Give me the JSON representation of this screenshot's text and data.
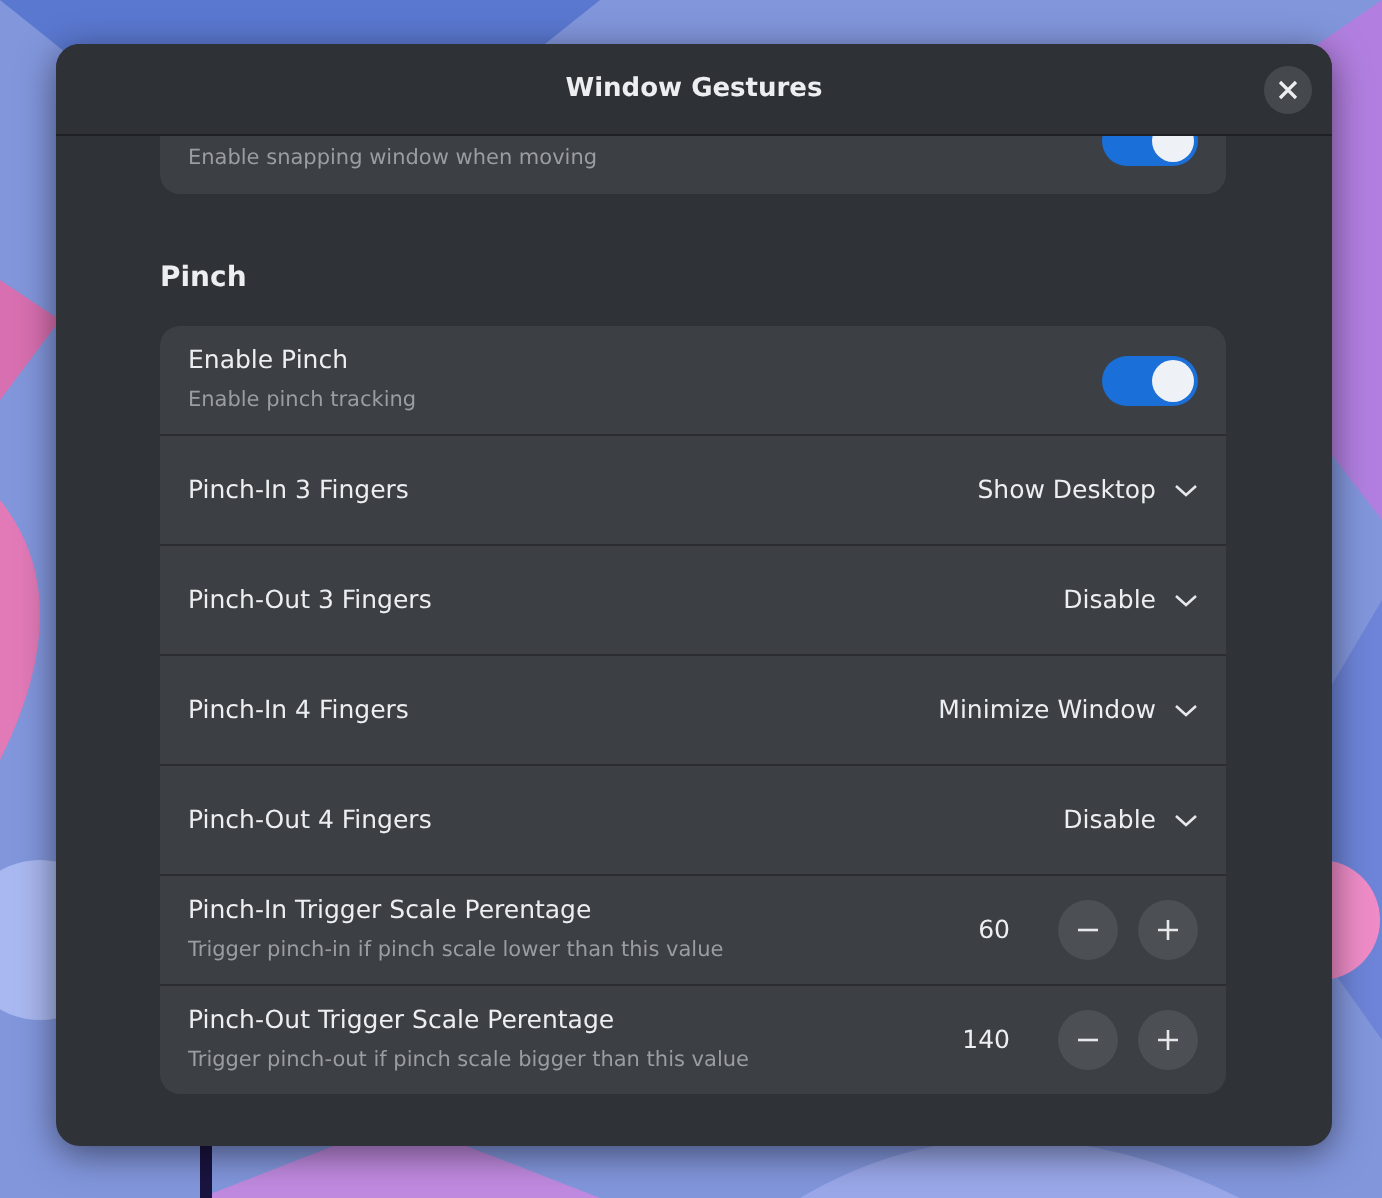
{
  "window": {
    "title": "Window Gestures"
  },
  "snap_row": {
    "subtitle": "Enable snapping window when moving",
    "on": true
  },
  "section": {
    "title": "Pinch"
  },
  "rows": [
    {
      "kind": "switch",
      "title": "Enable Pinch",
      "subtitle": "Enable pinch tracking",
      "on": true
    },
    {
      "kind": "dropdown",
      "title": "Pinch-In 3 Fingers",
      "value": "Show Desktop"
    },
    {
      "kind": "dropdown",
      "title": "Pinch-Out 3 Fingers",
      "value": "Disable"
    },
    {
      "kind": "dropdown",
      "title": "Pinch-In 4 Fingers",
      "value": "Minimize Window"
    },
    {
      "kind": "dropdown",
      "title": "Pinch-Out 4 Fingers",
      "value": "Disable"
    },
    {
      "kind": "spin",
      "title": "Pinch-In Trigger Scale Perentage",
      "subtitle": "Trigger pinch-in if pinch scale lower than this value",
      "value": "60"
    },
    {
      "kind": "spin",
      "title": "Pinch-Out Trigger Scale Perentage",
      "subtitle": "Trigger pinch-out if pinch scale bigger than this value",
      "value": "140"
    }
  ]
}
